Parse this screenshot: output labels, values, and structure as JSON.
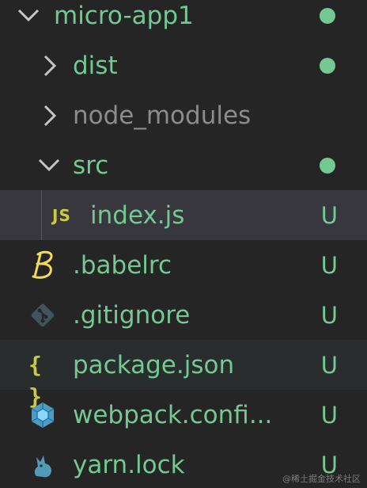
{
  "colors": {
    "background": "#252526",
    "selected_row": "#37373d",
    "folder_text_modified": "#73c991",
    "ignored_text": "#8c8c8c",
    "untracked_text": "#73c991",
    "chevron": "#c5c5c5",
    "dot": "#73c991",
    "js_icon": "#cbcb41",
    "babel_icon": "#f5da55",
    "git_icon": "#41535b",
    "json_icon": "#cbcb41",
    "webpack_icon": "#519aba",
    "yarn_icon": "#519aba"
  },
  "tree": {
    "root": {
      "name": "micro-app1",
      "expanded": true,
      "status": "modified-dot"
    },
    "folders": [
      {
        "name": "dist",
        "expanded": false,
        "status": "modified-dot"
      },
      {
        "name": "node_modules",
        "expanded": false,
        "status": "ignored"
      },
      {
        "name": "src",
        "expanded": true,
        "status": "modified-dot"
      }
    ],
    "src_children": [
      {
        "name": "index.js",
        "icon": "javascript-file-icon",
        "icon_text": "JS",
        "badge": "U"
      }
    ],
    "files": [
      {
        "name": ".babelrc",
        "icon": "babel-file-icon",
        "icon_text": "B",
        "badge": "U"
      },
      {
        "name": ".gitignore",
        "icon": "git-file-icon",
        "badge": "U"
      },
      {
        "name": "package.json",
        "icon": "json-file-icon",
        "icon_text": "{ }",
        "badge": "U"
      },
      {
        "name": "webpack.confi...",
        "icon": "webpack-file-icon",
        "badge": "U"
      },
      {
        "name": "yarn.lock",
        "icon": "yarn-file-icon",
        "badge": "U"
      }
    ]
  },
  "watermark": "@稀土掘金技术社区"
}
